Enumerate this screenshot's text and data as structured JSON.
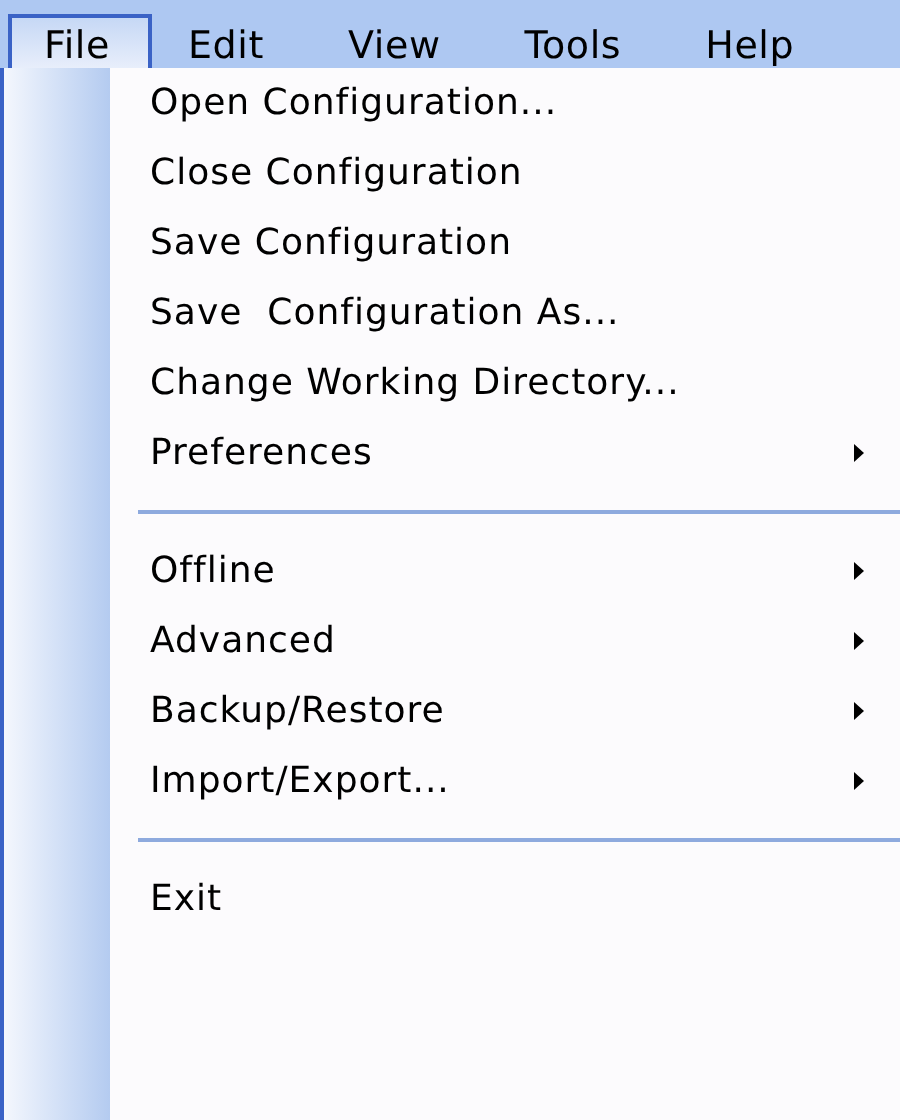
{
  "menu_bar": [
    {
      "label": "File",
      "selected": true
    },
    {
      "label": "Edit",
      "selected": false
    },
    {
      "label": "View",
      "selected": false
    },
    {
      "label": "Tools",
      "selected": false
    },
    {
      "label": "Help",
      "selected": false
    }
  ],
  "menu": {
    "items": [
      {
        "kind": "item",
        "label": "Open Configuration...",
        "submenu": false
      },
      {
        "kind": "item",
        "label": "Close Configuration",
        "submenu": false
      },
      {
        "kind": "item",
        "label": "Save Configuration",
        "submenu": false
      },
      {
        "kind": "item",
        "label": "Save  Configuration As...",
        "submenu": false
      },
      {
        "kind": "item",
        "label": "Change Working Directory...",
        "submenu": false
      },
      {
        "kind": "item",
        "label": "Preferences",
        "submenu": true
      },
      {
        "kind": "separator"
      },
      {
        "kind": "item",
        "label": "Offline",
        "submenu": true
      },
      {
        "kind": "item",
        "label": "Advanced",
        "submenu": true
      },
      {
        "kind": "item",
        "label": "Backup/Restore",
        "submenu": true
      },
      {
        "kind": "item",
        "label": "Import/Export...",
        "submenu": true
      },
      {
        "kind": "separator"
      },
      {
        "kind": "item",
        "label": "Exit",
        "submenu": false
      }
    ]
  }
}
